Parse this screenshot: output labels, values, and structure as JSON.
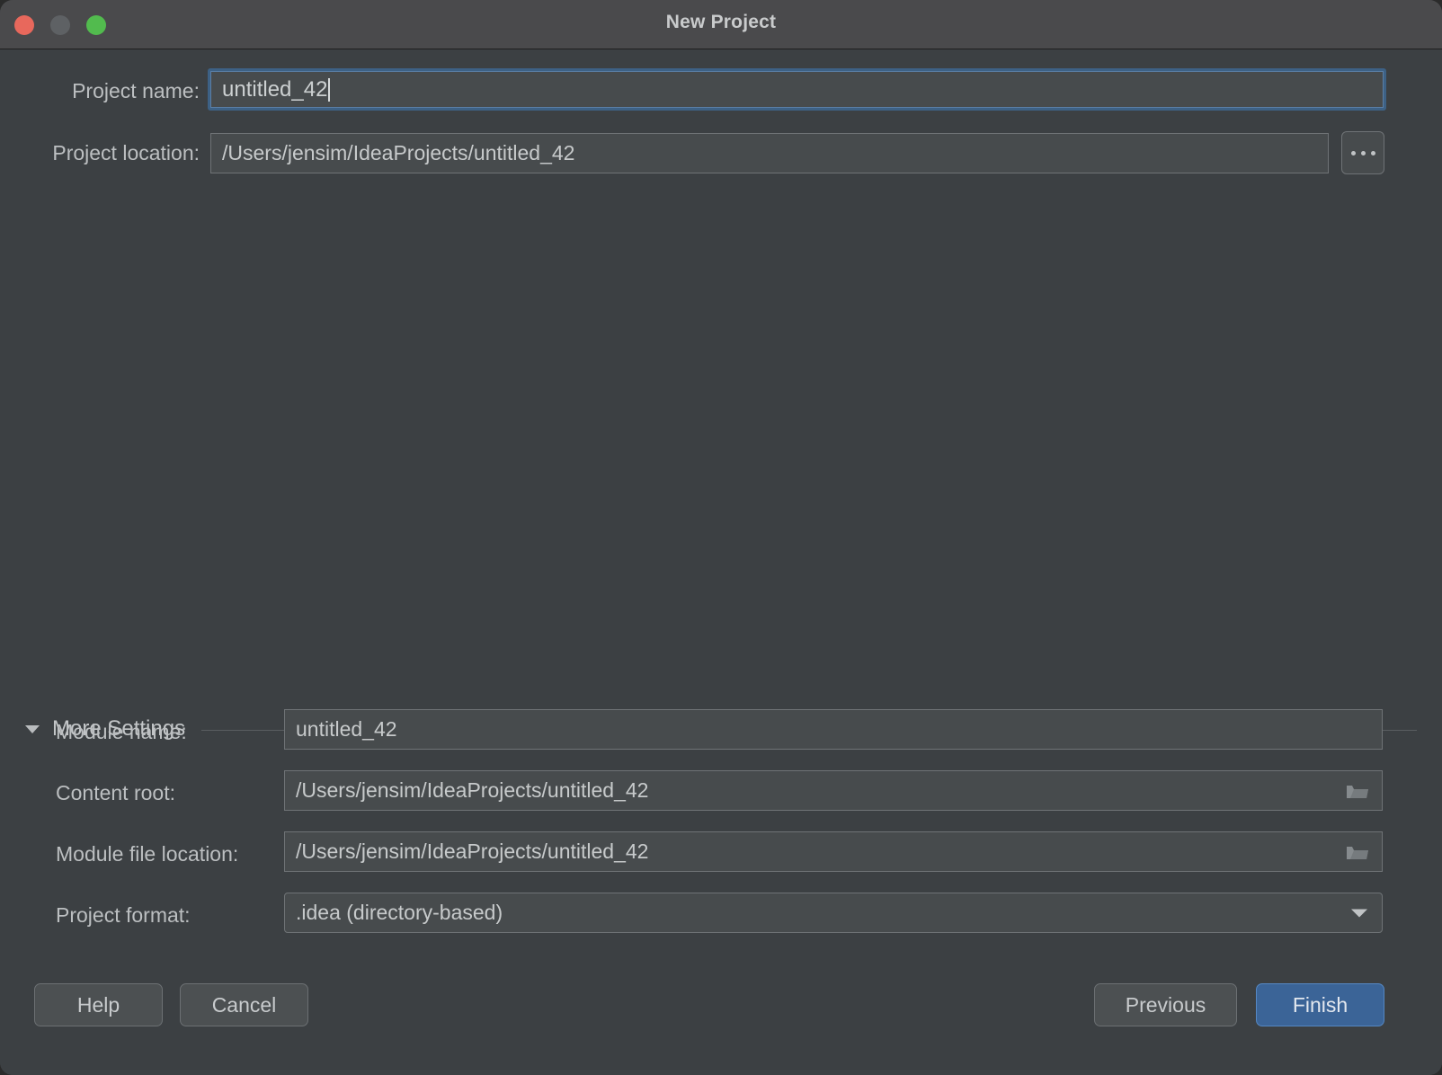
{
  "window": {
    "title": "New Project",
    "traffic_lights": [
      {
        "name": "close",
        "color": "#e8685c"
      },
      {
        "name": "minimize",
        "color": "#5e6164"
      },
      {
        "name": "zoom",
        "color": "#52bb4e"
      }
    ]
  },
  "top_form": {
    "project_name": {
      "label": "Project name:",
      "value": "untitled_42",
      "focused": true
    },
    "project_location": {
      "label": "Project location:",
      "value": "/Users/jensim/IdeaProjects/untitled_42"
    },
    "browse_button": {
      "label": "...",
      "icon": "ellipsis-icon"
    }
  },
  "more_settings": {
    "title": "More Settings",
    "expanded": true,
    "toggle_icon": "triangle-down-icon",
    "fields": [
      {
        "label": "Module name:",
        "value": "untitled_42",
        "icon": null
      },
      {
        "label": "Content root:",
        "value": "/Users/jensim/IdeaProjects/untitled_42",
        "icon": "folder-icon"
      },
      {
        "label": "Module file location:",
        "value": "/Users/jensim/IdeaProjects/untitled_42",
        "icon": "folder-icon"
      },
      {
        "label": "Project format:",
        "value": ".idea (directory-based)",
        "icon": "chevron-down-icon"
      }
    ]
  },
  "footer": {
    "help_label": "Help",
    "cancel_label": "Cancel",
    "previous_label": "Previous",
    "finish_label": "Finish",
    "finish_accent_color": "#3b6497"
  }
}
